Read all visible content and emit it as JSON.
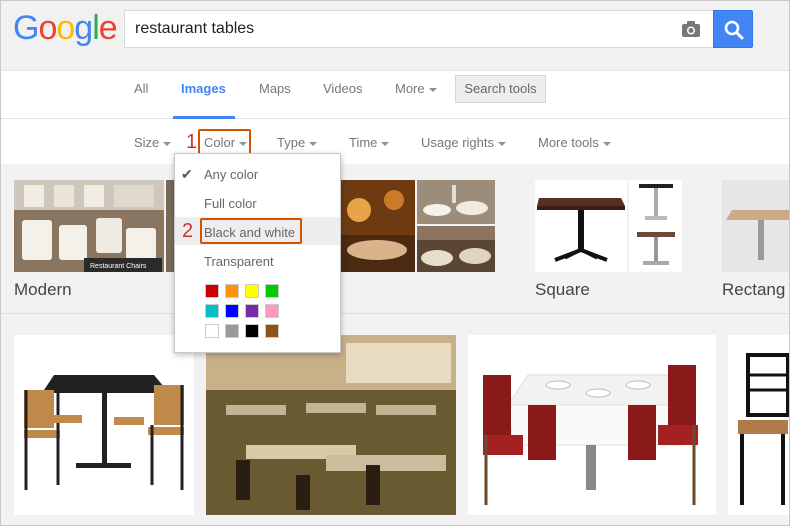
{
  "header": {
    "logo_letters": [
      {
        "ch": "G",
        "color": "#4285f4"
      },
      {
        "ch": "o",
        "color": "#ea4335"
      },
      {
        "ch": "o",
        "color": "#fbbc05"
      },
      {
        "ch": "g",
        "color": "#4285f4"
      },
      {
        "ch": "l",
        "color": "#34a853"
      },
      {
        "ch": "e",
        "color": "#ea4335"
      }
    ],
    "query": "restaurant tables"
  },
  "tabs": {
    "all": "All",
    "images": "Images",
    "maps": "Maps",
    "videos": "Videos",
    "more": "More",
    "search_tools": "Search tools"
  },
  "filters": {
    "size": "Size",
    "color": "Color",
    "type": "Type",
    "time": "Time",
    "usage_rights": "Usage rights",
    "more_tools": "More tools"
  },
  "annotations": {
    "step1": "1",
    "step2": "2",
    "highlight_color": "#d35400"
  },
  "dropdown": {
    "items": [
      "Any color",
      "Full color",
      "Black and white",
      "Transparent"
    ],
    "selected": "Any color",
    "hovered": "Black and white",
    "swatches": [
      "#cc0000",
      "#fb940b",
      "#ffff00",
      "#00cc00",
      "#03c0c6",
      "#0000ff",
      "#762ca7",
      "#ff98bf",
      "#ffffff",
      "#999999",
      "#000000",
      "#885418"
    ]
  },
  "categories": {
    "modern": "Modern",
    "square": "Square",
    "rectangle": "Rectang"
  },
  "thumb_texts": {
    "restaurant_chairs": "Restaurant Chairs"
  }
}
